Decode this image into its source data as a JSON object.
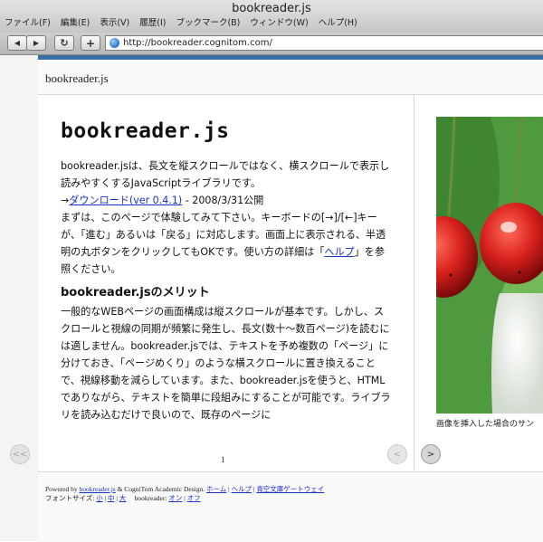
{
  "window": {
    "title": "bookreader.js"
  },
  "menu": [
    "ファイル(F)",
    "編集(E)",
    "表示(V)",
    "履歴(I)",
    "ブックマーク(B)",
    "ウィンドウ(W)",
    "ヘルプ(H)"
  ],
  "toolbar": {
    "back": "◀",
    "forward": "▶",
    "reload": "↻",
    "new_tab": "+",
    "url": "http://bookreader.cognitom.com/"
  },
  "site": {
    "name": "bookreader.js"
  },
  "article": {
    "title": "bookreader.js",
    "intro": "bookreader.jsは、長文を縦スクロールではなく、横スクロールで表示し読みやすくするJavaScriptライブラリです。",
    "download_prefix": "→",
    "download_link": "ダウンロード(ver 0.4.1)",
    "download_suffix": " - 2008/3/31公開",
    "instructions_before": "まずは、このページで体験してみて下さい。キーボードの[→]/[←]キーが、「進む」あるいは「戻る」に対応します。画面上に表示される、半透明の丸ボタンをクリックしてもOKです。使い方の詳細は「",
    "help_link": "ヘルプ",
    "instructions_after": "」を参照ください。",
    "section_title": "bookreader.jsのメリット",
    "section_body": "一般的なWEBページの画面構成は縦スクロールが基本です。しかし、スクロールと視線の同期が頻繁に発生し、長文(数十〜数百ページ)を読むには適しません。bookreader.jsでは、テキストを予め複数の「ページ」に分けておき、「ページめくり」のような横スクロールに置き換えることで、視線移動を減らしています。また、bookreader.jsを使うと、HTMLでありながら、テキストを簡単に段組みにすることが可能です。ライブラリを読み込むだけで良いので、既存のページに"
  },
  "pager": {
    "prev_left": "<<",
    "prev": "<",
    "next": ">",
    "page_number": "1"
  },
  "image_caption": "画像を挿入した場合のサン",
  "footer": {
    "powered_by": "Powered by ",
    "powered_link": "bookreader.js",
    "design_text": " & CogniTom Academic Design. ",
    "home_link": "ホーム",
    "sep1": " | ",
    "help_link": "ヘルプ",
    "sep2": " | ",
    "aozora_link": "青空文庫ゲートウェイ",
    "font_size_label": "フォントサイズ: ",
    "font_small": "小",
    "sep3": " | ",
    "font_medium": "中",
    "sep4": " | ",
    "font_large": "大",
    "bookreader_label": "     bookreader: ",
    "on_link": "オン",
    "sep5": " | ",
    "off_link": "オフ"
  },
  "colors": {
    "accent_bar": "#3b6ea5",
    "link": "#1a33c8",
    "cherry": "#d8201c"
  }
}
